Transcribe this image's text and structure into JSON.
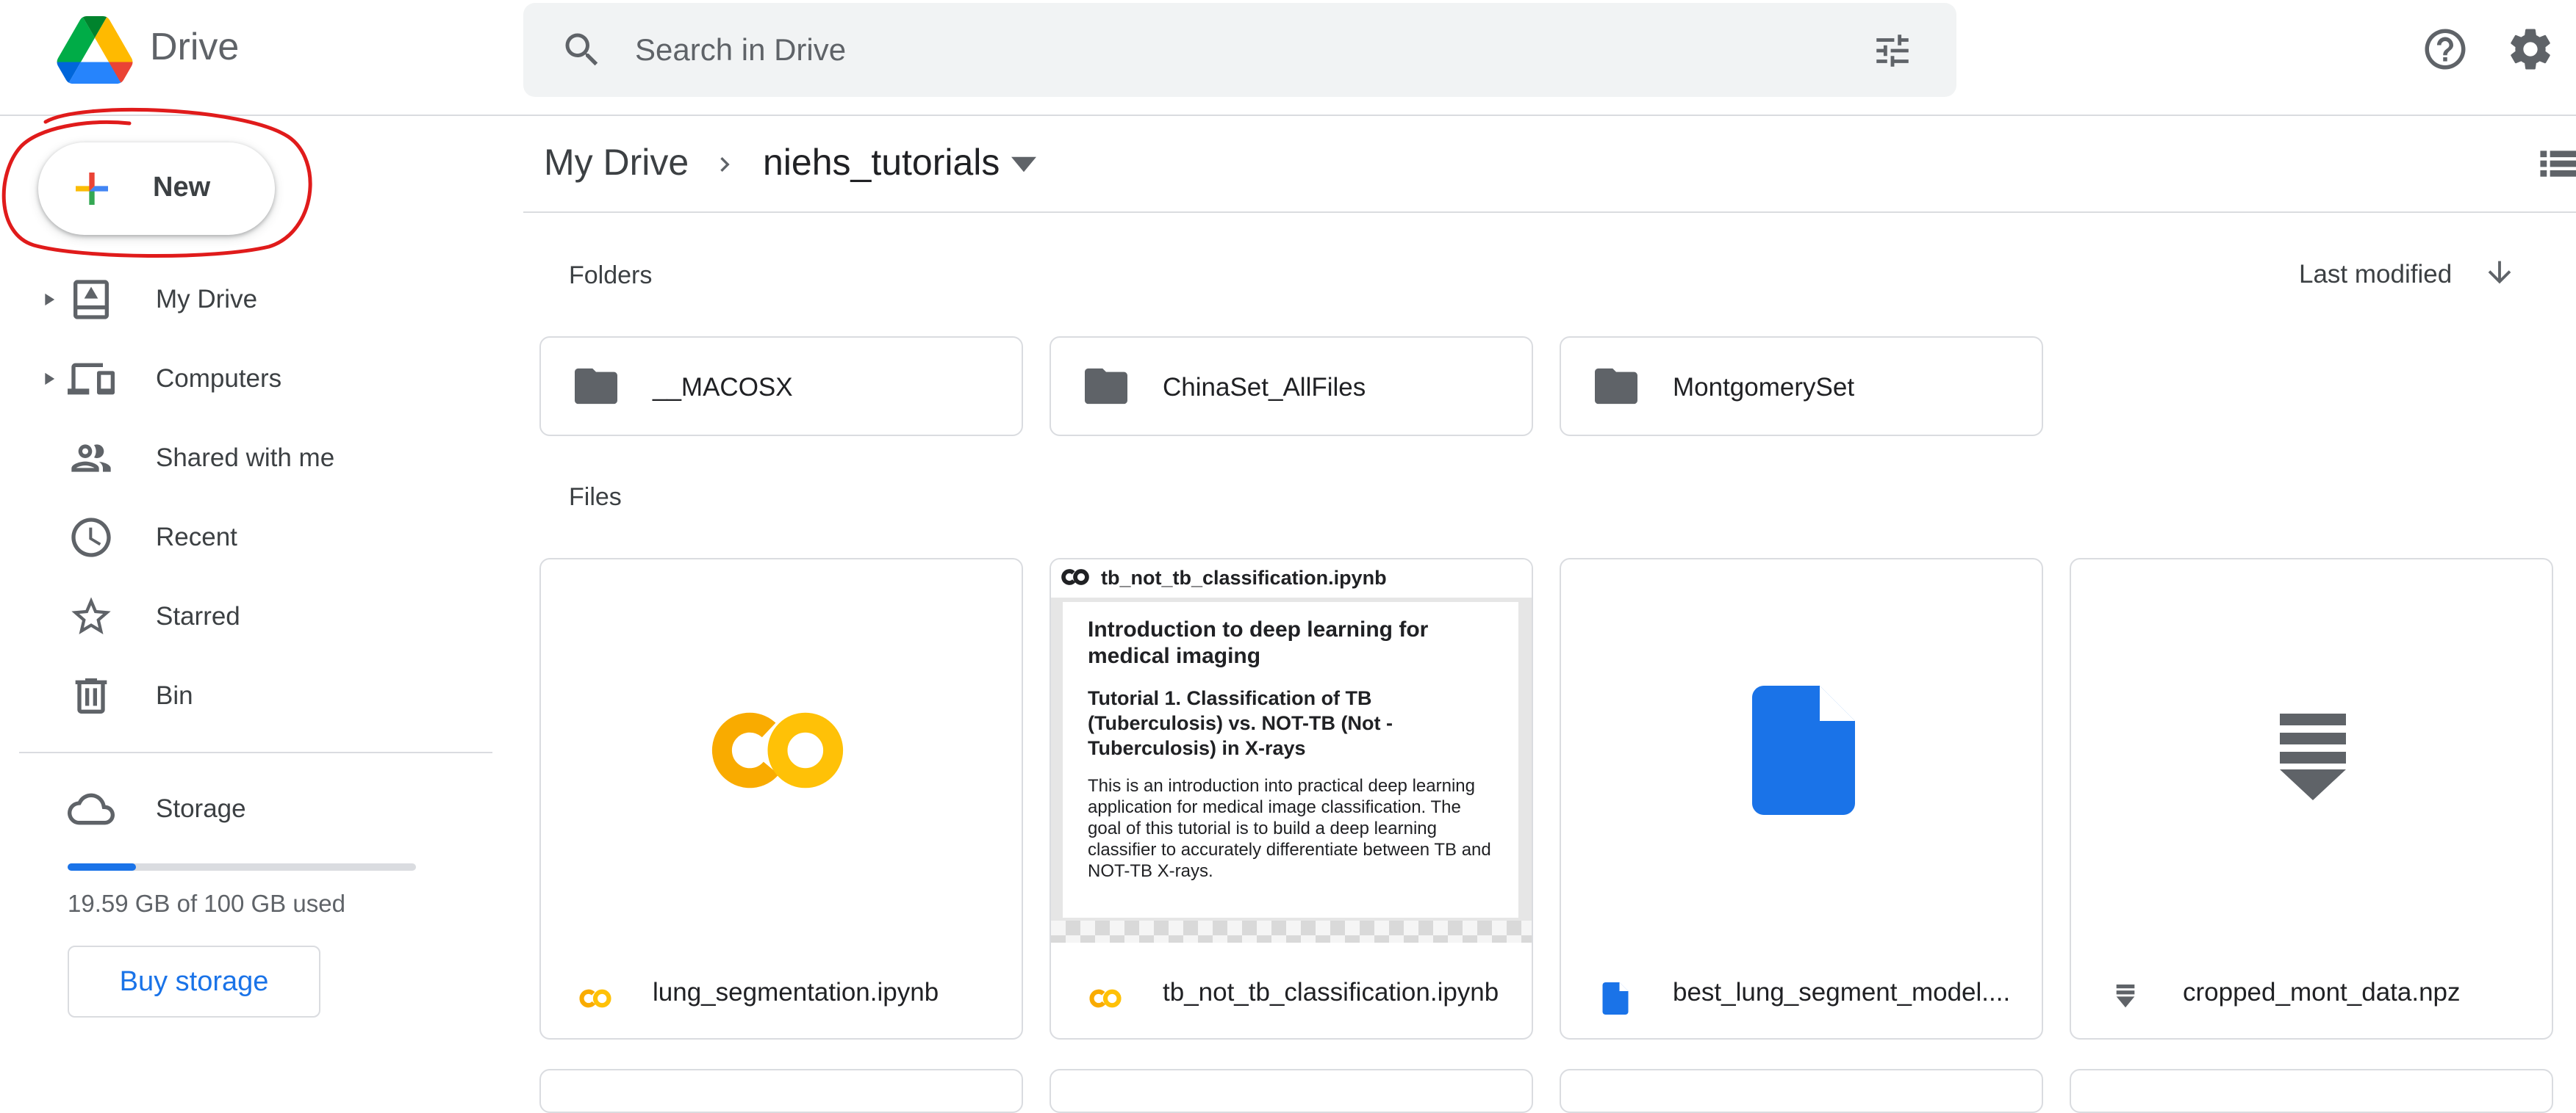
{
  "app": {
    "brand": "Drive"
  },
  "search": {
    "placeholder": "Search in Drive"
  },
  "sidebar": {
    "new_label": "New",
    "items": [
      {
        "label": "My Drive",
        "icon": "my-drive-icon",
        "expandable": true
      },
      {
        "label": "Computers",
        "icon": "computers-icon",
        "expandable": true
      },
      {
        "label": "Shared with me",
        "icon": "shared-icon",
        "expandable": false
      },
      {
        "label": "Recent",
        "icon": "clock-icon",
        "expandable": false
      },
      {
        "label": "Starred",
        "icon": "star-icon",
        "expandable": false
      },
      {
        "label": "Bin",
        "icon": "trash-icon",
        "expandable": false
      }
    ],
    "storage": {
      "label": "Storage",
      "used_text": "19.59 GB of 100 GB used",
      "used_fraction": 0.1959,
      "buy_label": "Buy storage"
    }
  },
  "breadcrumb": {
    "root": "My Drive",
    "current": "niehs_tutorials"
  },
  "sections": {
    "folders_label": "Folders",
    "files_label": "Files",
    "sort_label": "Last modified"
  },
  "folders": [
    {
      "name": "__MACOSX"
    },
    {
      "name": "ChinaSet_AllFiles"
    },
    {
      "name": "MontgomerySet"
    }
  ],
  "files": [
    {
      "name": "lung_segmentation.ipynb",
      "type": "colab-notebook"
    },
    {
      "name": "tb_not_tb_classification.ipynb",
      "type": "colab-notebook-preview"
    },
    {
      "name": "best_lung_segment_model....",
      "type": "google-doc"
    },
    {
      "name": "cropped_mont_data.npz",
      "type": "archive"
    }
  ],
  "preview": {
    "header_name": "tb_not_tb_classification.ipynb",
    "h1": "Introduction to deep learning for medical imaging",
    "h2": "Tutorial 1. Classification of TB (Tuberculosis) vs. NOT-TB (Not - Tuberculosis) in X-rays",
    "body": "This is an introduction into practical deep learning application for medical image classification. The goal of this tutorial is to build a deep learning classifier to accurately differentiate between TB and NOT-TB X-rays."
  },
  "colors": {
    "accent": "#1a73e8",
    "colab_orange": "#F9AB00",
    "colab_yellow": "#FFC107",
    "folder_gray": "#5f6368",
    "annotation_red": "#e01b1b"
  }
}
